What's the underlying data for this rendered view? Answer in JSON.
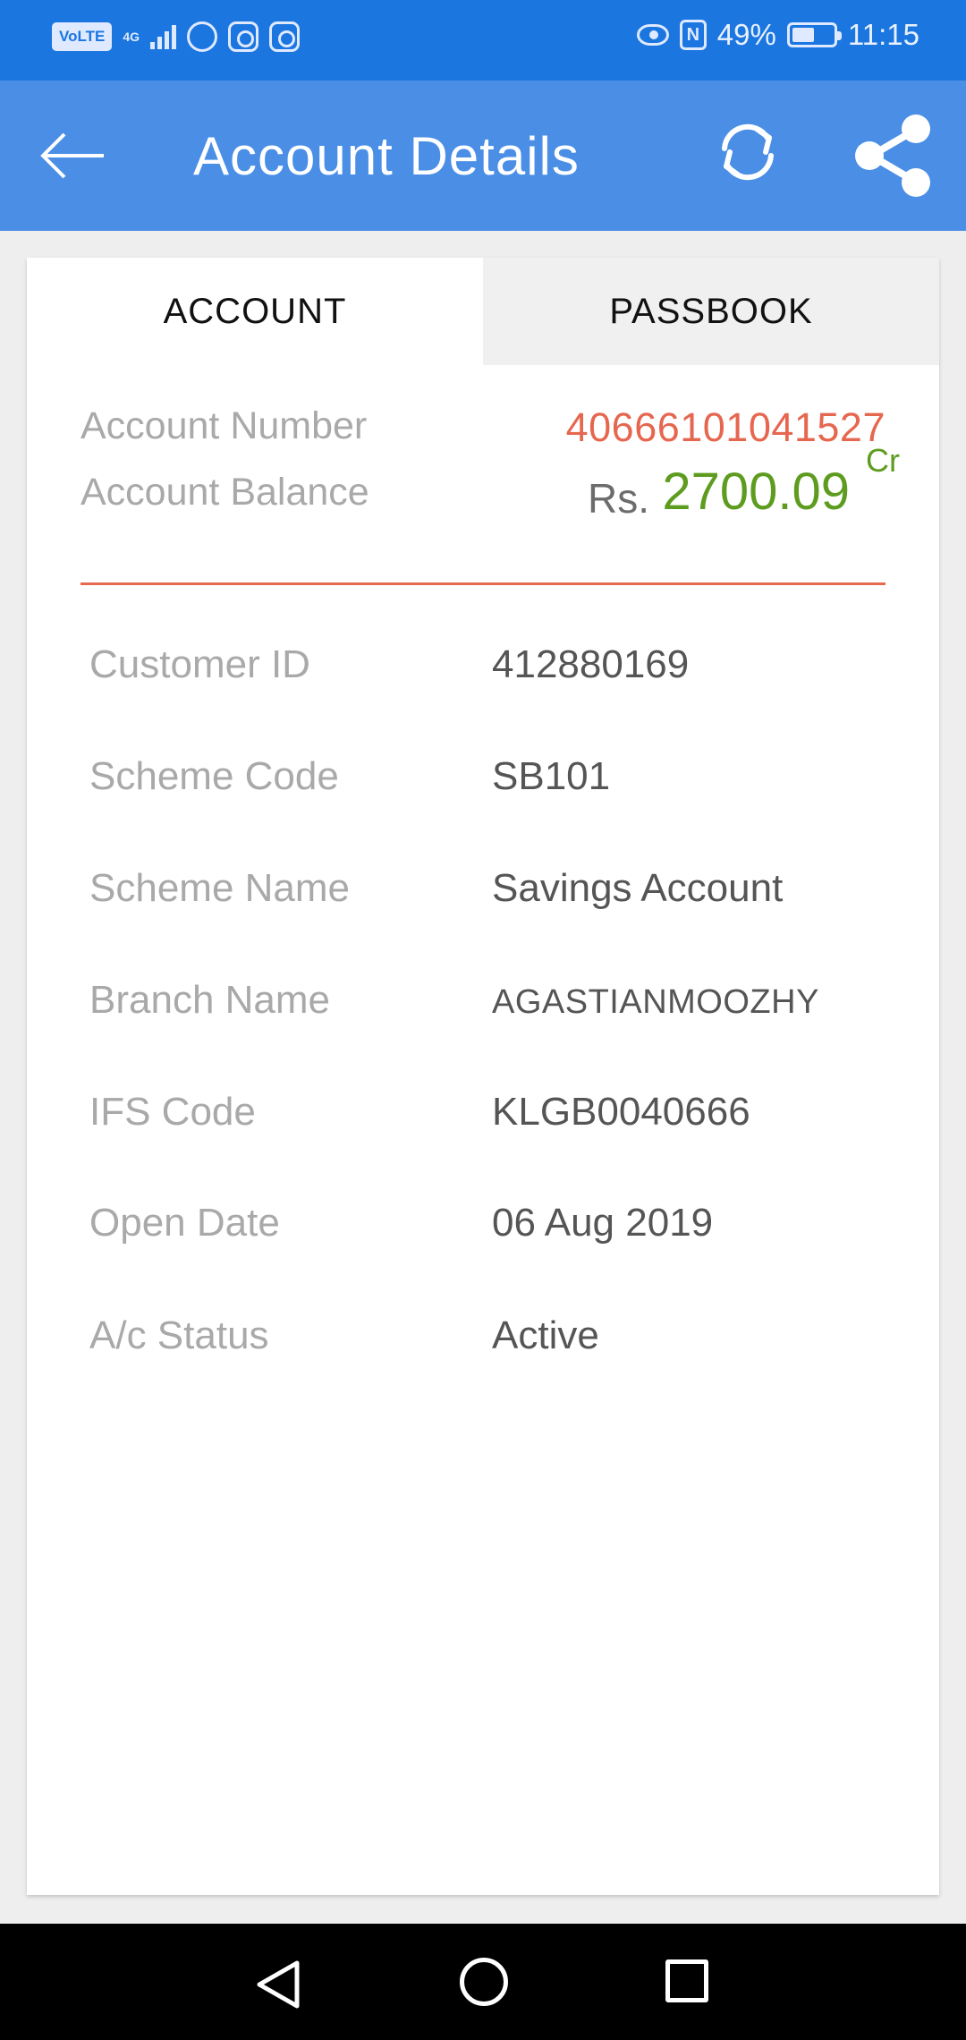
{
  "status_bar": {
    "volte": "VoLTE",
    "network": "4G",
    "battery_percent": "49%",
    "time": "11:15"
  },
  "app_bar": {
    "title": "Account Details"
  },
  "tabs": [
    {
      "label": "ACCOUNT",
      "active": true
    },
    {
      "label": "PASSBOOK",
      "active": false
    }
  ],
  "summary": {
    "account_number_label": "Account Number",
    "account_number": "40666101041527",
    "balance_label": "Account Balance",
    "currency": "Rs.",
    "balance": "2700.09",
    "balance_type": "Cr"
  },
  "details": [
    {
      "label": "Customer ID",
      "value": "412880169"
    },
    {
      "label": "Scheme Code",
      "value": "SB101"
    },
    {
      "label": "Scheme Name",
      "value": "Savings Account"
    },
    {
      "label": "Branch Name",
      "value": "AGASTIANMOOZHY"
    },
    {
      "label": "IFS Code",
      "value": "KLGB0040666"
    },
    {
      "label": "Open Date",
      "value": "06 Aug 2019"
    },
    {
      "label": "A/c Status",
      "value": "Active"
    }
  ],
  "colors": {
    "status_bar": "#1b76e0",
    "app_bar": "#4a8ee6",
    "account_number": "#e6674f",
    "balance": "#5e9c20",
    "divider": "#e66a4f"
  }
}
